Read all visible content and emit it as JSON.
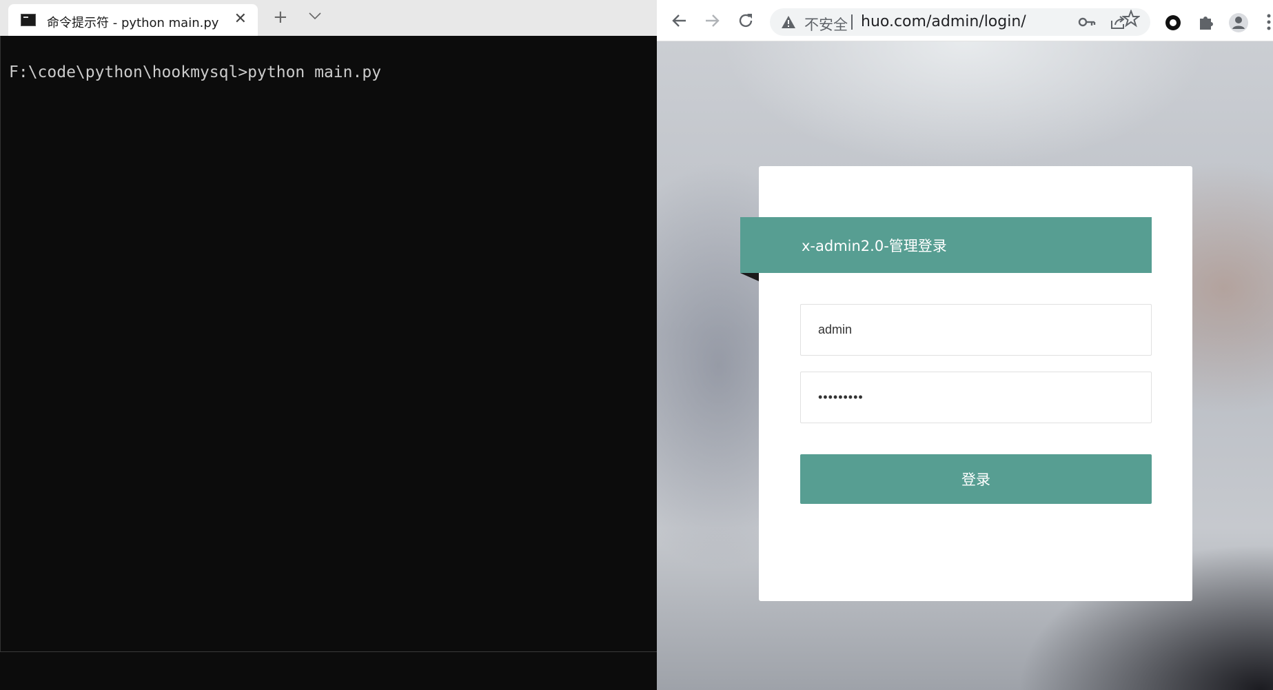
{
  "terminal": {
    "tab_title": "命令提示符 - python  main.py",
    "tab_close_glyph": "✕",
    "new_tab_glyph": "+",
    "command_line": "F:\\code\\python\\hookmysql>python main.py"
  },
  "browser": {
    "security_label": "不安全",
    "url": "huo.com/admin/login/",
    "icons": [
      "back-icon",
      "forward-icon",
      "reload-icon",
      "warning-icon",
      "key-icon",
      "share-icon",
      "star-icon",
      "record-icon",
      "extensions-icon",
      "profile-icon",
      "menu-icon"
    ]
  },
  "login": {
    "title": "x-admin2.0-管理登录",
    "username_value": "admin",
    "password_value": "•••••••••",
    "submit_label": "登录",
    "accent_color": "#579e92"
  }
}
